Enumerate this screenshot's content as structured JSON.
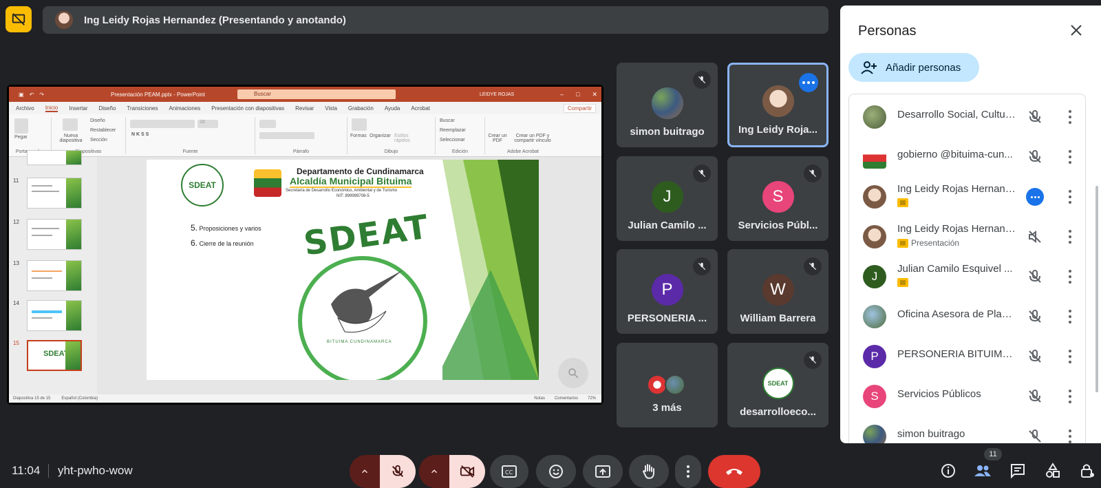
{
  "top_bar": {
    "badge_icon": "presentation-off-icon",
    "presenter_text": "Ing Leidy Rojas Hernandez (Presentando y anotando)"
  },
  "powerpoint": {
    "file_title": "Presentación PEAM.pptx - PowerPoint",
    "search_placeholder": "Buscar",
    "user": "LEIDYE ROJAS",
    "tabs": [
      "Archivo",
      "Inicio",
      "Insertar",
      "Diseño",
      "Transiciones",
      "Animaciones",
      "Presentación con diapositivas",
      "Revisar",
      "Vista",
      "Grabación",
      "Ayuda",
      "Acrobat"
    ],
    "share_label": "Compartir",
    "ribbon": {
      "paste": "Pegar",
      "new_slide": "Nueva diapositiva",
      "layout": "Diseño",
      "reset": "Restablecer",
      "section": "Sección",
      "shapes": "Formas",
      "arrange": "Organizar",
      "quick_styles": "Estilos rápidos",
      "find": "Buscar",
      "replace": "Reemplazar",
      "select": "Seleccionar",
      "create_pdf": "Crear un PDF",
      "create_share_pdf": "Crear un PDF y compartir vínculo",
      "font_size": "18",
      "groups": [
        "Portapapeles",
        "Diapositivas",
        "Fuente",
        "Párrafo",
        "Dibujo",
        "Edición",
        "Adobe Acrobat"
      ]
    },
    "thumb_numbers": [
      "11",
      "12",
      "13",
      "14",
      "15"
    ],
    "slide": {
      "department": "Departamento de Cundinamarca",
      "mayor_office": "Alcaldía Municipal Bituima",
      "secretary": "Secretaría de Desarrollo Económico, Ambiental y de Turismo",
      "nit": "NIT: 899999708-5",
      "items": [
        {
          "num": "5.",
          "text": "Proposiciones y varios"
        },
        {
          "num": "6.",
          "text": "Cierre de la reunión"
        }
      ],
      "logo_text": "SDEAT",
      "logo_small": "SDEAT",
      "ring_text": "BITUIMA CUNDINAMARCA"
    },
    "status": {
      "slide_count": "Diapositiva 15 de 15",
      "language": "Español (Colombia)",
      "notes": "Notas",
      "comments": "Comentarios",
      "zoom": "72%"
    }
  },
  "tiles": [
    {
      "name": "simon buitrago",
      "avatar": "photo",
      "muted": true
    },
    {
      "name": "Ing Leidy Roja...",
      "avatar": "photo",
      "active": true
    },
    {
      "name": "Julian Camilo ...",
      "initial": "J",
      "color": "#2e5c1f",
      "muted": true
    },
    {
      "name": "Servicios Públ...",
      "initial": "S",
      "color": "#e8457a",
      "muted": true
    },
    {
      "name": "PERSONERIA ...",
      "initial": "P",
      "color": "#5b2aa8",
      "muted": true
    },
    {
      "name": "William Barrera",
      "initial": "W",
      "color": "#5a3a2e",
      "muted": true
    },
    {
      "name": "3 más"
    },
    {
      "name": "desarrolloeco...",
      "avatar": "photo",
      "muted": true
    }
  ],
  "panel": {
    "title": "Personas",
    "add_label": "Añadir personas",
    "people": [
      {
        "name": "Desarrollo Social, Cultur...",
        "avatar": "photo",
        "color": "#6d8a5a"
      },
      {
        "name": "gobierno @bituima-cun...",
        "avatar": "photo",
        "color": "#d33"
      },
      {
        "name": "Ing Leidy Rojas Hernand...",
        "avatar": "photo",
        "color": "#b98a72",
        "presenting": true,
        "more_blue": true
      },
      {
        "name": "Ing Leidy Rojas Hernand...",
        "avatar": "photo",
        "color": "#b98a72",
        "sub": "Presentación",
        "presenting": true
      },
      {
        "name": "Julian Camilo Esquivel ...",
        "initial": "J",
        "color": "#2e5c1f",
        "presenting": true
      },
      {
        "name": "Oficina Asesora de Plan...",
        "avatar": "photo",
        "color": "#6b8fb0"
      },
      {
        "name": "PERSONERIA BITUIMA ...",
        "initial": "P",
        "color": "#5b2aa8"
      },
      {
        "name": "Servicios Públicos",
        "initial": "S",
        "color": "#e8457a"
      },
      {
        "name": "simon buitrago",
        "avatar": "photo",
        "color": "#7a8f5a"
      }
    ]
  },
  "bottom_bar": {
    "time": "11:04",
    "meeting_code": "yht-pwho-wow",
    "people_count": "11"
  },
  "colors": {
    "background": "#202124",
    "tile": "#3c4043",
    "accent_blue": "#1a73e8",
    "end_call": "#dc362e",
    "muted_bg": "#f9dedc"
  }
}
